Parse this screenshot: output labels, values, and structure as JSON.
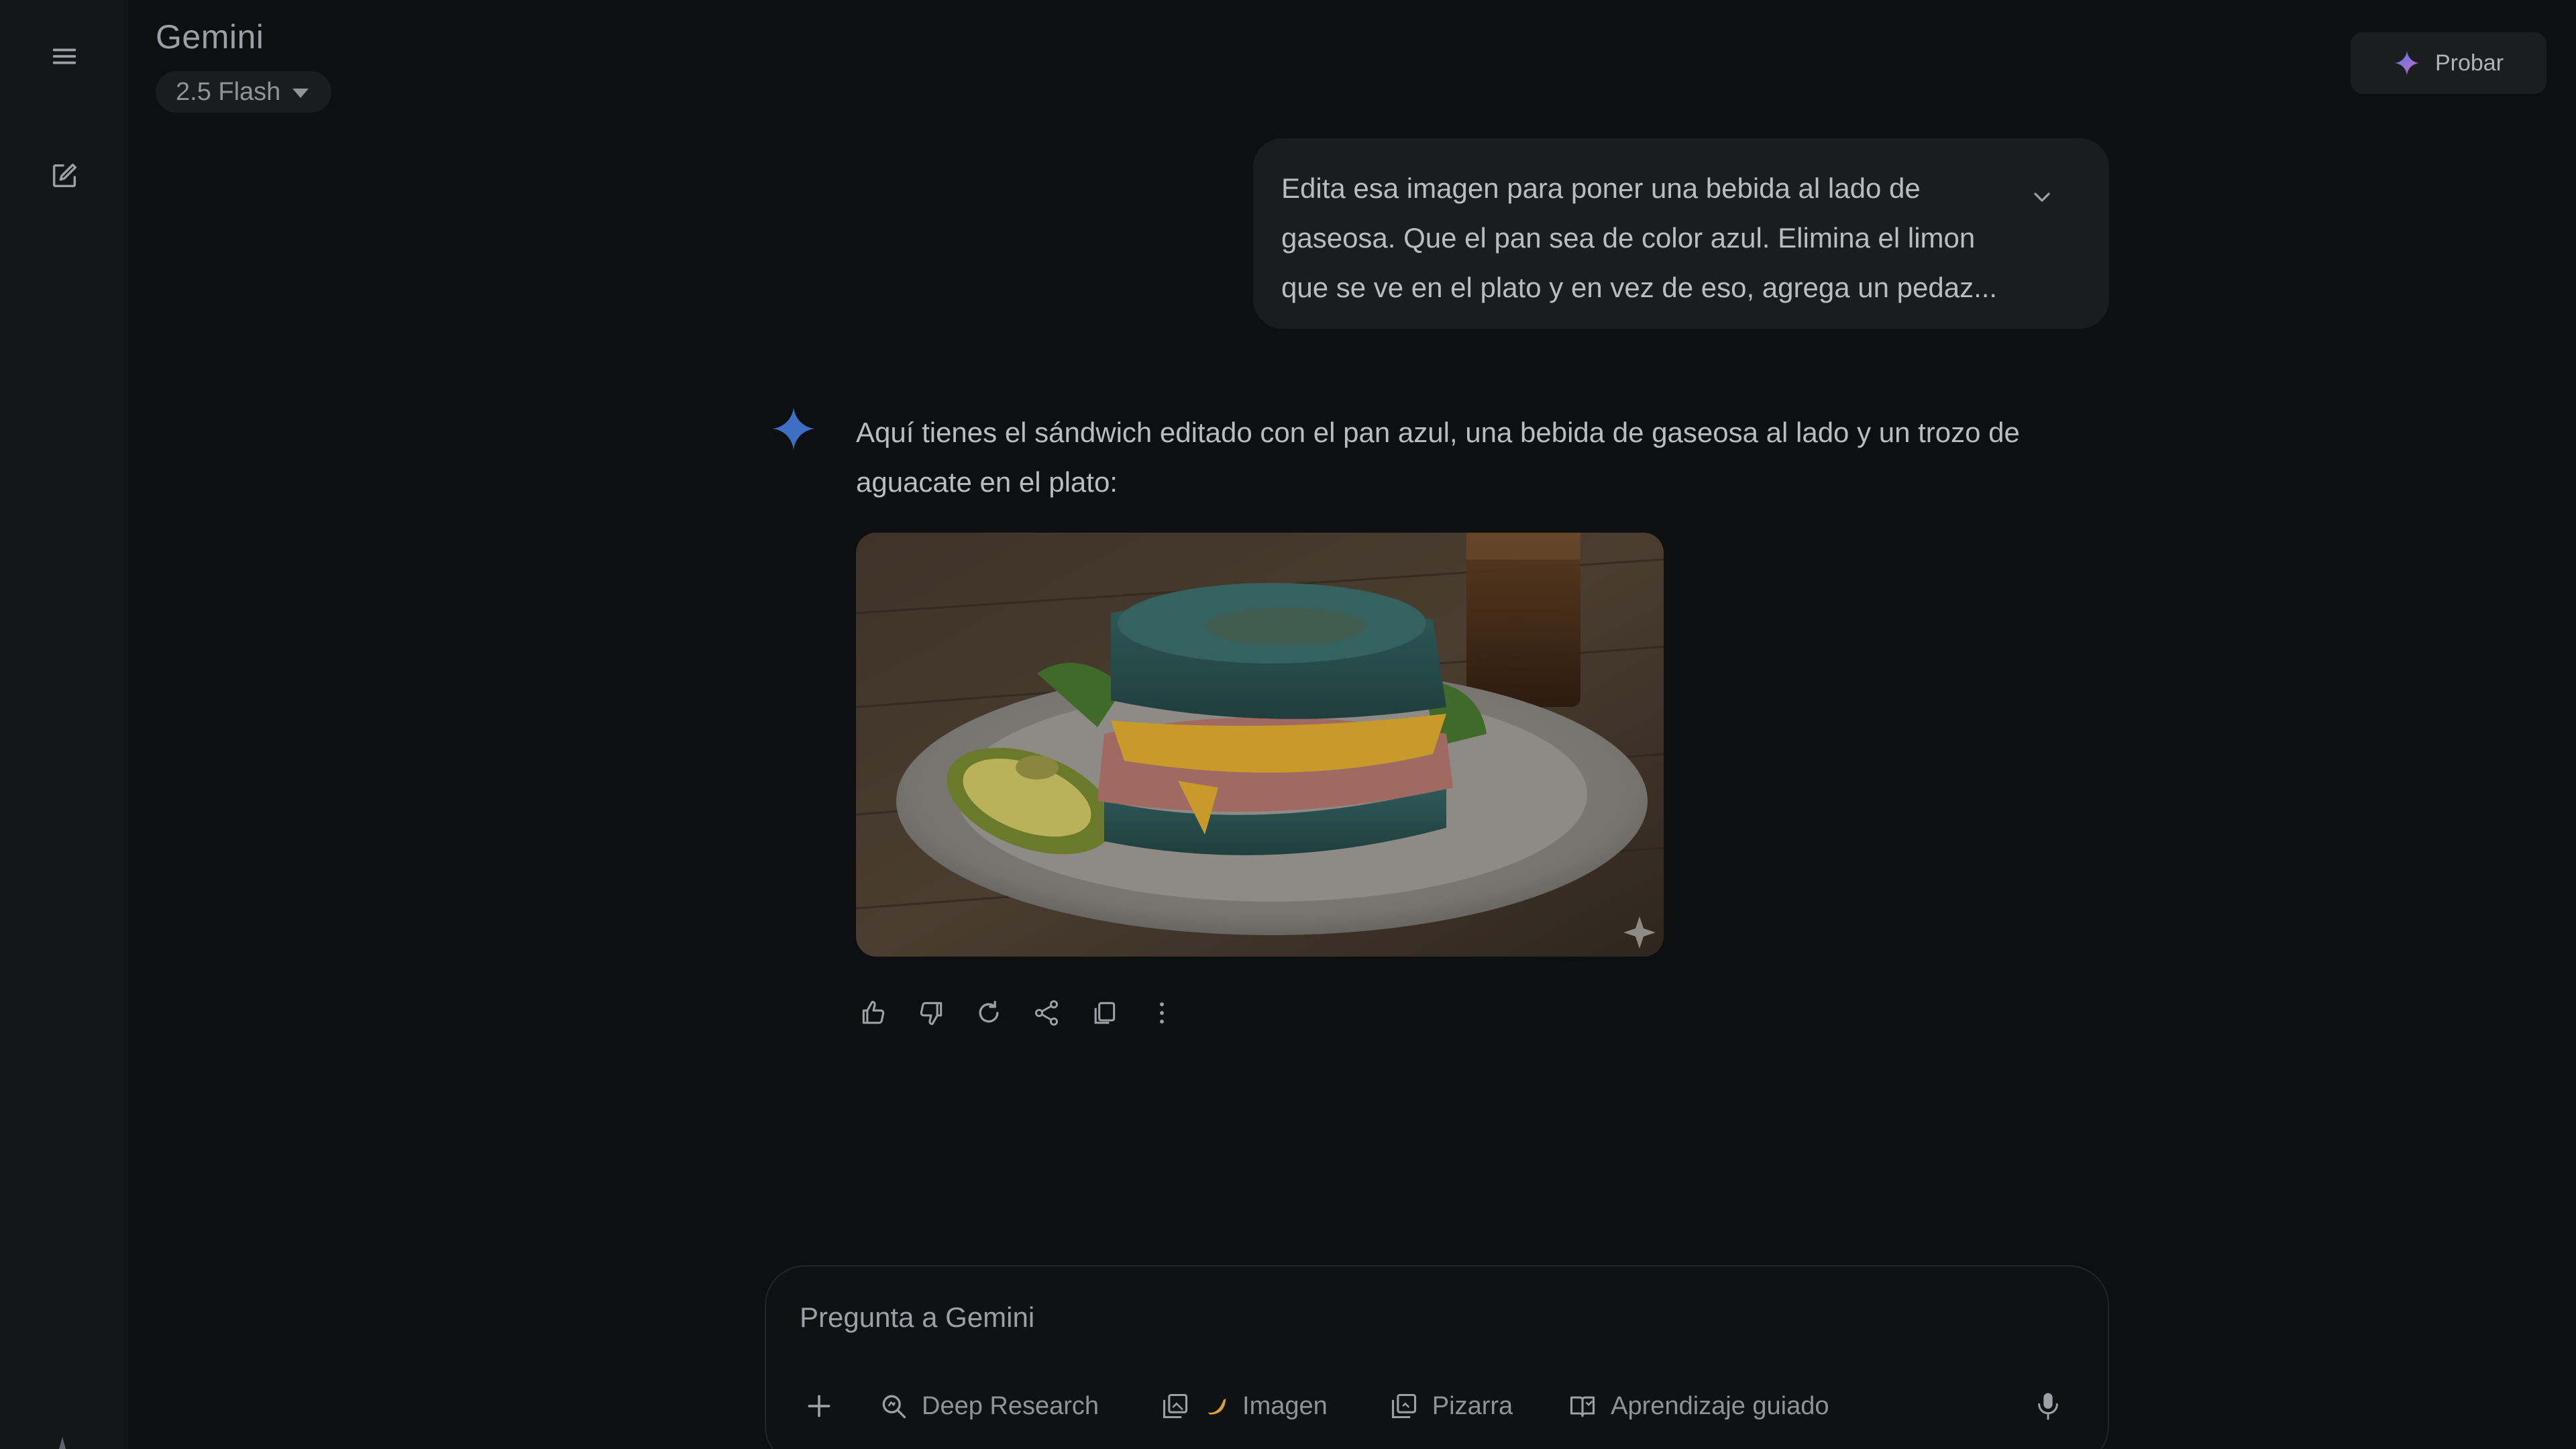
{
  "app": {
    "brand": "Gemini",
    "model": "2.5 Flash",
    "try_label": "Probar"
  },
  "icons": {
    "menu": "menu-icon",
    "new_chat": "edit-icon",
    "try": "gemini-spark-icon",
    "expand": "chevron-down-icon",
    "response": "gemini-spark-icon",
    "actions": [
      "thumb-up-icon",
      "thumb-down-icon",
      "refresh-icon",
      "share-icon",
      "copy-icon",
      "more-vert-icon"
    ],
    "composer": [
      "plus-icon",
      "deep-research-icon",
      "image-icon",
      "canvas-icon",
      "guided-learning-icon",
      "mic-icon"
    ]
  },
  "user_message": {
    "lines": [
      "Edita esa imagen para poner una bebida al lado de",
      "gaseosa. Que el pan sea de color azul. Elimina el limon",
      "que se ve en el plato y en vez de eso, agrega un pedaz..."
    ]
  },
  "response": {
    "lines": [
      "Aquí tienes el sándwich editado con el pan azul, una bebida de gaseosa al lado y un trozo de",
      "aguacate en el plato:"
    ]
  },
  "composer": {
    "placeholder": "Pregunta a Gemini",
    "tools": {
      "deep_research": "Deep Research",
      "image": "Imagen",
      "canvas": "Pizarra",
      "guided": "Aprendizaje guiado"
    }
  },
  "colors": {
    "background": "#0e0f10",
    "rail": "#141516",
    "bubble": "#1b1c1e",
    "accent_blue": "#4c7fd9",
    "text": "#b9bdc1"
  }
}
